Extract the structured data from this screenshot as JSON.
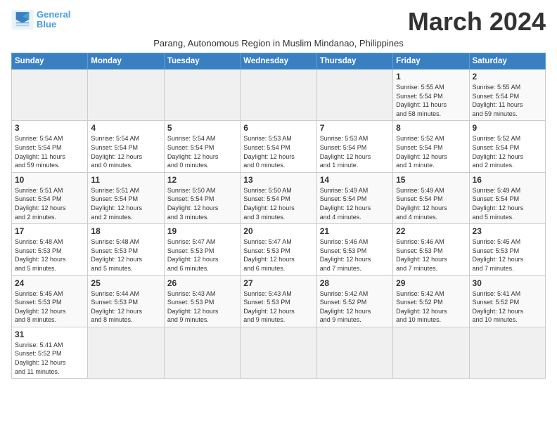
{
  "header": {
    "logo_line1": "General",
    "logo_line2": "Blue",
    "month_title": "March 2024",
    "subtitle": "Parang, Autonomous Region in Muslim Mindanao, Philippines"
  },
  "days_of_week": [
    "Sunday",
    "Monday",
    "Tuesday",
    "Wednesday",
    "Thursday",
    "Friday",
    "Saturday"
  ],
  "weeks": [
    [
      {
        "day": "",
        "info": ""
      },
      {
        "day": "",
        "info": ""
      },
      {
        "day": "",
        "info": ""
      },
      {
        "day": "",
        "info": ""
      },
      {
        "day": "",
        "info": ""
      },
      {
        "day": "1",
        "info": "Sunrise: 5:55 AM\nSunset: 5:54 PM\nDaylight: 11 hours\nand 58 minutes."
      },
      {
        "day": "2",
        "info": "Sunrise: 5:55 AM\nSunset: 5:54 PM\nDaylight: 11 hours\nand 59 minutes."
      }
    ],
    [
      {
        "day": "3",
        "info": "Sunrise: 5:54 AM\nSunset: 5:54 PM\nDaylight: 11 hours\nand 59 minutes."
      },
      {
        "day": "4",
        "info": "Sunrise: 5:54 AM\nSunset: 5:54 PM\nDaylight: 12 hours\nand 0 minutes."
      },
      {
        "day": "5",
        "info": "Sunrise: 5:54 AM\nSunset: 5:54 PM\nDaylight: 12 hours\nand 0 minutes."
      },
      {
        "day": "6",
        "info": "Sunrise: 5:53 AM\nSunset: 5:54 PM\nDaylight: 12 hours\nand 0 minutes."
      },
      {
        "day": "7",
        "info": "Sunrise: 5:53 AM\nSunset: 5:54 PM\nDaylight: 12 hours\nand 1 minute."
      },
      {
        "day": "8",
        "info": "Sunrise: 5:52 AM\nSunset: 5:54 PM\nDaylight: 12 hours\nand 1 minute."
      },
      {
        "day": "9",
        "info": "Sunrise: 5:52 AM\nSunset: 5:54 PM\nDaylight: 12 hours\nand 2 minutes."
      }
    ],
    [
      {
        "day": "10",
        "info": "Sunrise: 5:51 AM\nSunset: 5:54 PM\nDaylight: 12 hours\nand 2 minutes."
      },
      {
        "day": "11",
        "info": "Sunrise: 5:51 AM\nSunset: 5:54 PM\nDaylight: 12 hours\nand 2 minutes."
      },
      {
        "day": "12",
        "info": "Sunrise: 5:50 AM\nSunset: 5:54 PM\nDaylight: 12 hours\nand 3 minutes."
      },
      {
        "day": "13",
        "info": "Sunrise: 5:50 AM\nSunset: 5:54 PM\nDaylight: 12 hours\nand 3 minutes."
      },
      {
        "day": "14",
        "info": "Sunrise: 5:49 AM\nSunset: 5:54 PM\nDaylight: 12 hours\nand 4 minutes."
      },
      {
        "day": "15",
        "info": "Sunrise: 5:49 AM\nSunset: 5:54 PM\nDaylight: 12 hours\nand 4 minutes."
      },
      {
        "day": "16",
        "info": "Sunrise: 5:49 AM\nSunset: 5:54 PM\nDaylight: 12 hours\nand 5 minutes."
      }
    ],
    [
      {
        "day": "17",
        "info": "Sunrise: 5:48 AM\nSunset: 5:53 PM\nDaylight: 12 hours\nand 5 minutes."
      },
      {
        "day": "18",
        "info": "Sunrise: 5:48 AM\nSunset: 5:53 PM\nDaylight: 12 hours\nand 5 minutes."
      },
      {
        "day": "19",
        "info": "Sunrise: 5:47 AM\nSunset: 5:53 PM\nDaylight: 12 hours\nand 6 minutes."
      },
      {
        "day": "20",
        "info": "Sunrise: 5:47 AM\nSunset: 5:53 PM\nDaylight: 12 hours\nand 6 minutes."
      },
      {
        "day": "21",
        "info": "Sunrise: 5:46 AM\nSunset: 5:53 PM\nDaylight: 12 hours\nand 7 minutes."
      },
      {
        "day": "22",
        "info": "Sunrise: 5:46 AM\nSunset: 5:53 PM\nDaylight: 12 hours\nand 7 minutes."
      },
      {
        "day": "23",
        "info": "Sunrise: 5:45 AM\nSunset: 5:53 PM\nDaylight: 12 hours\nand 7 minutes."
      }
    ],
    [
      {
        "day": "24",
        "info": "Sunrise: 5:45 AM\nSunset: 5:53 PM\nDaylight: 12 hours\nand 8 minutes."
      },
      {
        "day": "25",
        "info": "Sunrise: 5:44 AM\nSunset: 5:53 PM\nDaylight: 12 hours\nand 8 minutes."
      },
      {
        "day": "26",
        "info": "Sunrise: 5:43 AM\nSunset: 5:53 PM\nDaylight: 12 hours\nand 9 minutes."
      },
      {
        "day": "27",
        "info": "Sunrise: 5:43 AM\nSunset: 5:53 PM\nDaylight: 12 hours\nand 9 minutes."
      },
      {
        "day": "28",
        "info": "Sunrise: 5:42 AM\nSunset: 5:52 PM\nDaylight: 12 hours\nand 9 minutes."
      },
      {
        "day": "29",
        "info": "Sunrise: 5:42 AM\nSunset: 5:52 PM\nDaylight: 12 hours\nand 10 minutes."
      },
      {
        "day": "30",
        "info": "Sunrise: 5:41 AM\nSunset: 5:52 PM\nDaylight: 12 hours\nand 10 minutes."
      }
    ],
    [
      {
        "day": "31",
        "info": "Sunrise: 5:41 AM\nSunset: 5:52 PM\nDaylight: 12 hours\nand 11 minutes."
      },
      {
        "day": "",
        "info": ""
      },
      {
        "day": "",
        "info": ""
      },
      {
        "day": "",
        "info": ""
      },
      {
        "day": "",
        "info": ""
      },
      {
        "day": "",
        "info": ""
      },
      {
        "day": "",
        "info": ""
      }
    ]
  ]
}
